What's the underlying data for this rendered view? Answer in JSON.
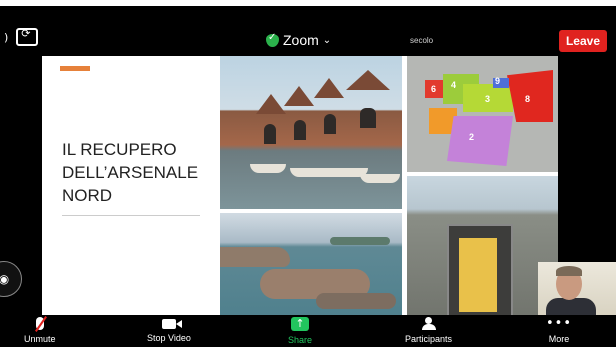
{
  "app": {
    "title": "Zoom",
    "leave_label": "Leave",
    "section_label": "secolo"
  },
  "slide": {
    "title": "IL RECUPERO\nDELL’ARSENALE\nNORD",
    "accent_color": "#e6813a"
  },
  "map_zones": [
    "6",
    "4",
    "3",
    "9",
    "8",
    "2"
  ],
  "toolbar": {
    "items": [
      {
        "label": "Unmute",
        "icon": "mic-muted-icon"
      },
      {
        "label": "Stop Video",
        "icon": "video-camera-icon"
      },
      {
        "label": "Share",
        "icon": "share-arrow-icon"
      },
      {
        "label": "Participants",
        "icon": "participants-icon"
      },
      {
        "label": "More",
        "icon": "more-dots-icon"
      }
    ]
  },
  "colors": {
    "leave": "#e0221f",
    "share": "#22c55e",
    "secure": "#2bb24c"
  }
}
